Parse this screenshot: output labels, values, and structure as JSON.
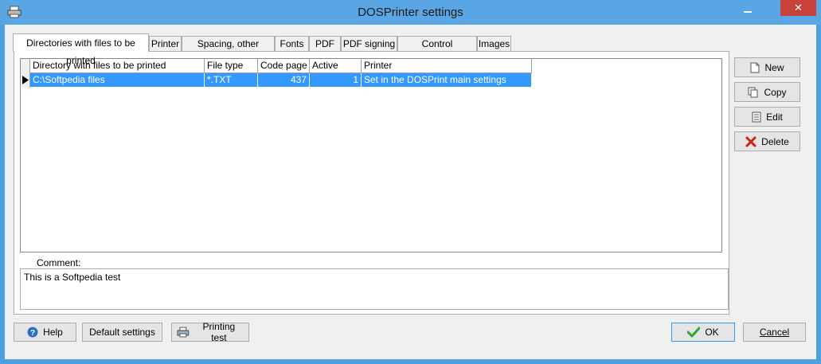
{
  "window": {
    "title": "DOSPrinter settings",
    "close_label": "✕"
  },
  "tabs": [
    "Directories with files to be printed",
    "Printer",
    "Spacing, other options",
    "Fonts",
    "PDF",
    "PDF signing",
    "Control sequences",
    "Images"
  ],
  "table": {
    "columns": [
      "Directory with files to be printed",
      "File type",
      "Code page",
      "Active",
      "Printer"
    ],
    "rows": [
      {
        "directory": "C:\\Softpedia files",
        "file_type": "*.TXT",
        "code_page": "437",
        "active": "1",
        "printer": "Set in the DOSPrint main settings"
      }
    ]
  },
  "side_buttons": {
    "new": "New",
    "copy": "Copy",
    "edit": "Edit",
    "delete": "Delete"
  },
  "comment": {
    "label": "Comment:",
    "value": "This is a Softpedia test"
  },
  "bottom_buttons": {
    "help": "Help",
    "defaults": "Default settings",
    "printing_test": "Printing test",
    "ok": "OK",
    "cancel": "Cancel"
  },
  "colors": {
    "titlebar": "#5aa6e4",
    "selection": "#3399ff",
    "close": "#c7423a"
  }
}
